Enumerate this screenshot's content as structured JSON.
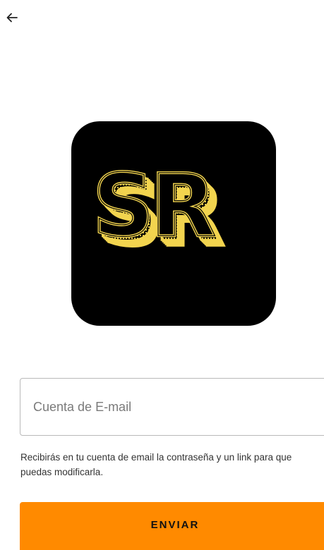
{
  "header": {
    "back_icon": "arrow-left-icon"
  },
  "logo": {
    "text": "SR",
    "tile_color": "#000000",
    "accent_color": "#f2d44f"
  },
  "form": {
    "email_placeholder": "Cuenta de E-mail",
    "email_value": "",
    "help_text": "Recibirás en tu cuenta de email la contraseña y un link para que puedas modificarla.",
    "submit_label": "ENVIAR",
    "submit_color": "#ff8a00"
  }
}
